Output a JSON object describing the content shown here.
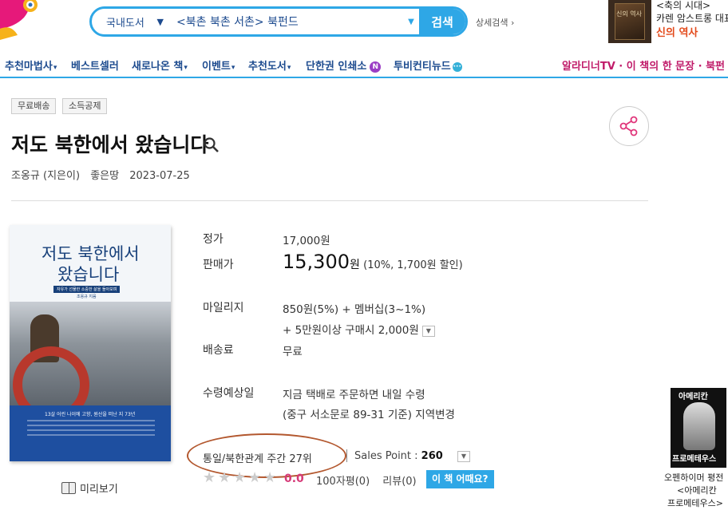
{
  "search": {
    "category": "국내도서",
    "query": "<북촌 북촌 서촌> 북펀드",
    "button_label": "검색",
    "advanced_label": "상세검색 ›"
  },
  "promo": {
    "line1": "<축의 시대>",
    "line2": "카렌 암스트롱 대표",
    "line3": "신의 역사",
    "cover_text": "신의 역사"
  },
  "nav": {
    "items": [
      {
        "label": "추천마법사",
        "caret": "▾"
      },
      {
        "label": "베스트셀러",
        "caret": ""
      },
      {
        "label": "새로나온 책",
        "caret": "▾"
      },
      {
        "label": "이벤트",
        "caret": "▾"
      },
      {
        "label": "추천도서",
        "caret": "▾"
      },
      {
        "label": "단한권 인쇄소",
        "caret": ""
      },
      {
        "label": "투비컨티뉴드",
        "caret": ""
      }
    ],
    "badge_n": "N",
    "badge_dots": "···",
    "right_text": "알라디너TV · 이 책의 한 문장 · 북펀"
  },
  "tags": [
    "무료배송",
    "소득공제"
  ],
  "book": {
    "title": "저도 북한에서 왔습니다",
    "author": "조옹규 (지은이)",
    "publisher": "좋은땅",
    "date": "2023-07-25"
  },
  "cover": {
    "title_line1": "저도 북한에서",
    "title_line2": "왔습니다",
    "subtitle": "자유가 선물한 소중한 삶을 돌아보며",
    "author": "조옹규 지음",
    "bottom_line": "13살 어린 나이에 고향, 원산을 떠난 지 73년"
  },
  "preview_label": "미리보기",
  "pricing": {
    "list_label": "정가",
    "list_value": "17,000원",
    "sale_label": "판매가",
    "sale_value": "15,300",
    "sale_won": "원",
    "sale_discount": "(10%, 1,700원 할인)",
    "mileage_label": "마일리지",
    "mileage_value": "850원(5%) + 멤버십(3~1%)",
    "mileage_extra": "+ 5만원이상 구매시 2,000원",
    "shipping_label": "배송료",
    "shipping_value": "무료",
    "delivery_label": "수령예상일",
    "delivery_value": "지금 택배로 주문하면 내일 수령",
    "delivery_location": "(중구 서소문로 89-31 기준) 지역변경"
  },
  "ranking": {
    "text": "통일/북한관계 주간 27위",
    "sales_label": "Sales Point : ",
    "sales_value": "260"
  },
  "rating": {
    "score": "0.0",
    "short_review": "100자평(0)",
    "review": "리뷰(0)",
    "how_button": "이 책 어때요?",
    "star_count": 5
  },
  "side_ad": {
    "cover_top": "아메리칸",
    "cover_bottom": "프로메테우스",
    "caption1": "오펜하이머 평전",
    "caption2": "<아메리칸",
    "caption3": "프로메테우스>"
  },
  "colors": {
    "accent": "#2ea7e6",
    "nav_text": "#1d4b8f",
    "nav_right": "#c01c6a",
    "score": "#d63a78",
    "highlight_circle": "#b3582f"
  }
}
